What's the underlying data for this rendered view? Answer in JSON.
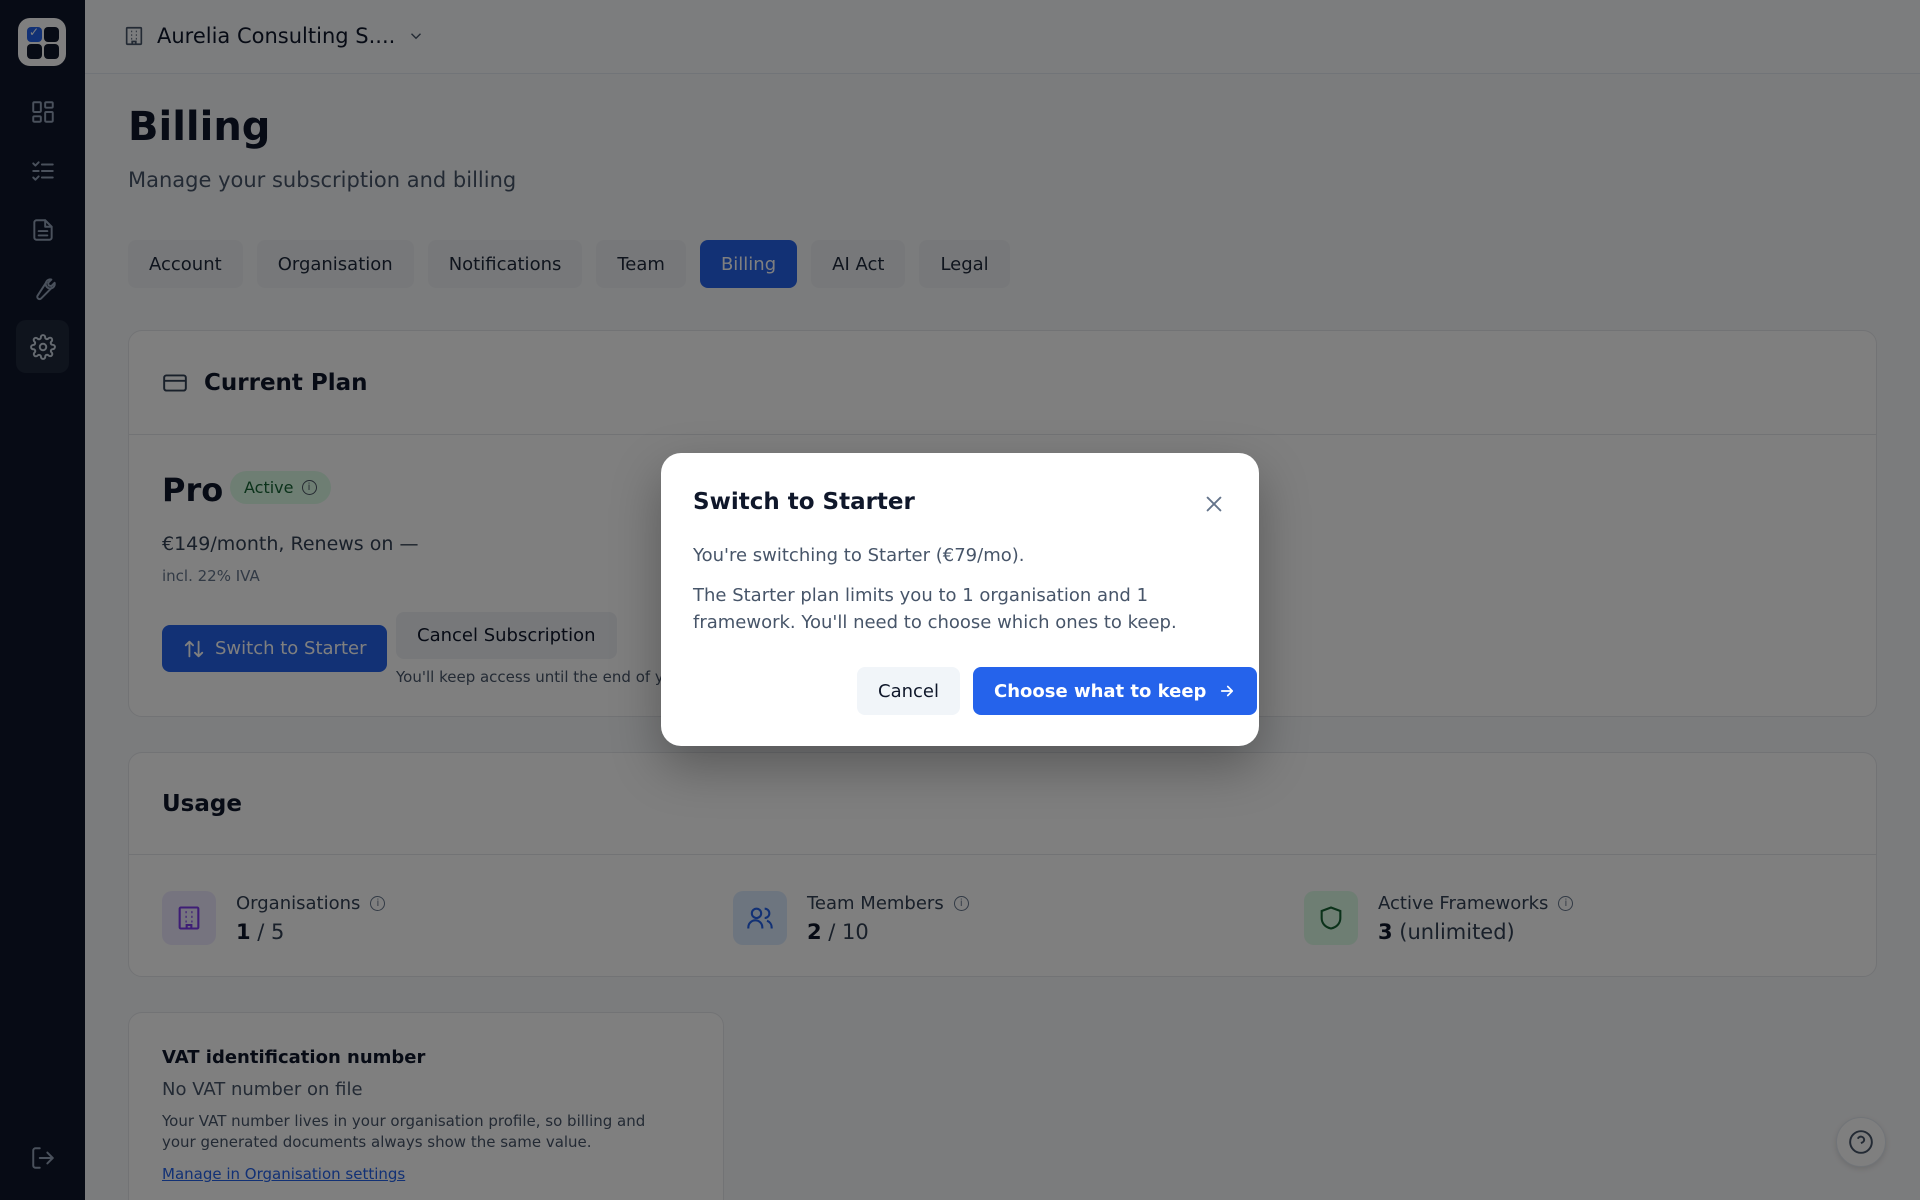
{
  "org": {
    "name": "Aurelia Consulting S...."
  },
  "page": {
    "title": "Billing",
    "subtitle": "Manage your subscription and billing"
  },
  "tabs": [
    {
      "label": "Account"
    },
    {
      "label": "Organisation"
    },
    {
      "label": "Notifications"
    },
    {
      "label": "Team"
    },
    {
      "label": "Billing",
      "active": true
    },
    {
      "label": "AI Act"
    },
    {
      "label": "Legal"
    }
  ],
  "current_plan": {
    "heading": "Current Plan",
    "plan_name": "Pro",
    "status": "Active",
    "price": "€149/month, Renews on —",
    "vat_note": "incl. 22% IVA",
    "switch_label": "Switch to Starter",
    "cancel_label": "Cancel Subscription",
    "cancel_note": "You'll keep access until the end of yo"
  },
  "usage": {
    "heading": "Usage",
    "items": [
      {
        "label": "Organisations",
        "value": "1",
        "suffix": " / 5"
      },
      {
        "label": "Team Members",
        "value": "2",
        "suffix": " / 10"
      },
      {
        "label": "Active Frameworks",
        "value": "3",
        "suffix": " (unlimited)"
      }
    ]
  },
  "vat": {
    "title": "VAT identification number",
    "status": "No VAT number on file",
    "description": "Your VAT number lives in your organisation profile, so billing and your generated documents always show the same value.",
    "link": "Manage in Organisation settings"
  },
  "modal": {
    "title": "Switch to Starter",
    "line1": "You're switching to Starter (€79/mo).",
    "line2": "The Starter plan limits you to 1 organisation and 1 framework. You'll need to choose which ones to keep.",
    "cancel": "Cancel",
    "confirm": "Choose what to keep"
  },
  "colors": {
    "accent": "#2563eb",
    "sidebar": "#0f172a",
    "active_badge": "#dcfce7"
  },
  "icons": {
    "sidebar": [
      "dashboard-icon",
      "checklist-icon",
      "document-icon",
      "wrench-icon",
      "gear-icon",
      "logout-icon"
    ],
    "topbar": [
      "building-icon",
      "chevron-down-icon"
    ],
    "other": [
      "credit-card-icon",
      "info-icon",
      "switch-arrows-icon",
      "users-icon",
      "shield-icon",
      "help-icon",
      "close-icon",
      "arrow-right-icon"
    ]
  }
}
